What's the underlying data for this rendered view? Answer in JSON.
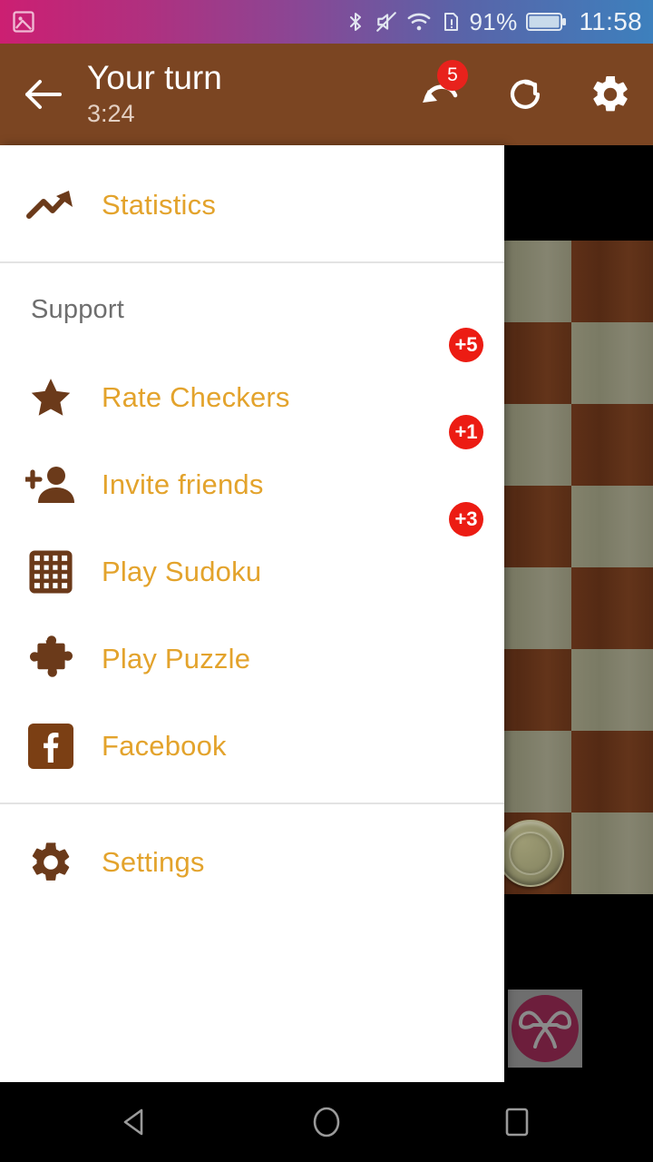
{
  "status_bar": {
    "left_icons": [
      {
        "name": "screenshot-icon"
      }
    ],
    "right_icons": [
      {
        "name": "bluetooth-icon"
      },
      {
        "name": "mute-icon"
      },
      {
        "name": "wifi-icon"
      },
      {
        "name": "sim-card-alert-icon"
      }
    ],
    "battery_percent": "91%",
    "clock": "11:58"
  },
  "toolbar": {
    "back_icon": "arrow-back-icon",
    "title": "Your turn",
    "subtitle": "3:24",
    "undo": {
      "icon": "undo-icon",
      "badge": "5"
    },
    "redo": {
      "icon": "redo-icon"
    },
    "settings": {
      "icon": "gear-icon"
    },
    "background_color": "#7b4522"
  },
  "drawer": {
    "accent_color": "#e3a32c",
    "icon_color": "#6b3a1a",
    "badge_color": "#ec1c13",
    "top_items": [
      {
        "label": "Statistics",
        "icon": "trending-up-icon",
        "badge": null
      }
    ],
    "section_header": "Support",
    "support_items": [
      {
        "label": "Rate Checkers",
        "icon": "star-icon",
        "badge": "+5"
      },
      {
        "label": "Invite friends",
        "icon": "person-add-icon",
        "badge": "+1"
      },
      {
        "label": "Play Sudoku",
        "icon": "grid-icon",
        "badge": "+3"
      },
      {
        "label": "Play Puzzle",
        "icon": "puzzle-piece-icon",
        "badge": null
      },
      {
        "label": "Facebook",
        "icon": "facebook-icon",
        "badge": null
      }
    ],
    "bottom_items": [
      {
        "label": "Settings",
        "icon": "gear-icon",
        "badge": null
      }
    ]
  },
  "board": {
    "light_square_color": "#7e7d67",
    "dark_square_color": "#5c2e17",
    "piece_color": "#8b8a66",
    "pieces": [
      {
        "row": 5,
        "col": 3
      },
      {
        "row": 7,
        "col": 2
      }
    ]
  },
  "ad": {
    "logo_name": "heart-ee-logo",
    "logo_color": "#6d1e3c",
    "backdrop_color": "#6e6e6e"
  },
  "nav_bar": {
    "back": "nav-back-icon",
    "home": "nav-home-icon",
    "recents": "nav-recents-icon"
  }
}
